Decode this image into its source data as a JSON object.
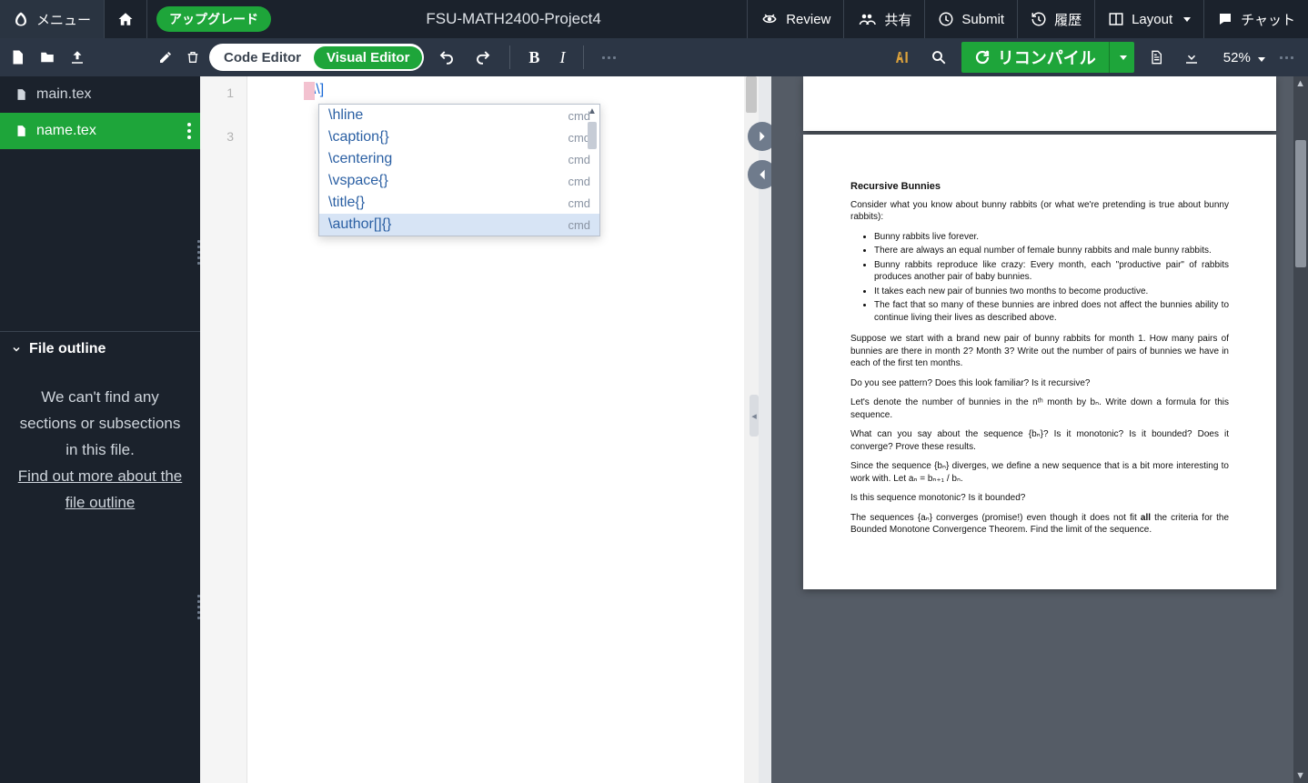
{
  "topbar": {
    "menu": "メニュー",
    "upgrade": "アップグレード",
    "project_title": "FSU-MATH2400-Project4",
    "review": "Review",
    "share": "共有",
    "submit": "Submit",
    "history": "履歴",
    "layout": "Layout",
    "chat": "チャット"
  },
  "toolbar": {
    "code_editor": "Code Editor",
    "visual_editor": "Visual Editor",
    "recompile": "リコンパイル",
    "zoom": "52%"
  },
  "files": {
    "main": "main.tex",
    "name": "name.tex"
  },
  "outline": {
    "header": "File outline",
    "empty": "We can't find any sections or subsections in this file.",
    "link": "Find out more about the file outline"
  },
  "editor": {
    "lines": [
      "1",
      "3"
    ],
    "code_prefix": "\\[",
    "code_inner": "\\",
    "code_suffix": "\\]"
  },
  "autocomplete": {
    "tag": "cmd",
    "items": [
      "\\hline",
      "\\caption{}",
      "\\centering",
      "\\vspace{}",
      "\\title{}",
      "\\author[]{}"
    ],
    "selected": 5
  },
  "pdf": {
    "title": "Recursive Bunnies",
    "intro": "Consider what you know about bunny rabbits (or what we're pretending is true about bunny rabbits):",
    "bullets": [
      "Bunny rabbits live forever.",
      "There are always an equal number of female bunny rabbits and male bunny rabbits.",
      "Bunny rabbits reproduce like crazy: Every month, each \"productive pair\" of rabbits produces another pair of baby bunnies.",
      "It takes each new pair of bunnies two months to become productive.",
      "The fact that so many of these bunnies are inbred does not affect the bunnies ability to continue living their lives as described above."
    ],
    "p1": "Suppose we start with a brand new pair of bunny rabbits for month 1. How many pairs of bunnies are there in month 2? Month 3? Write out the number of pairs of bunnies we have in each of the first ten months.",
    "p2": "Do you see pattern? Does this look familiar? Is it recursive?",
    "p3": "Let's denote the number of bunnies in the nᵗʰ month by bₙ. Write down a formula for this sequence.",
    "p4": "What can you say about the sequence {bₙ}? Is it monotonic? Is it bounded? Does it converge? Prove these results.",
    "p5": "Since the sequence {bₙ} diverges, we define a new sequence that is a bit more interesting to work with. Let aₙ = bₙ₊₁ / bₙ.",
    "p6": "Is this sequence monotonic? Is it bounded?",
    "p7a": "The sequences {aₙ} converges (promise!) even though it does not fit ",
    "p7b": "all",
    "p7c": " the criteria for the Bounded Monotone Convergence Theorem. Find the limit of the sequence."
  }
}
